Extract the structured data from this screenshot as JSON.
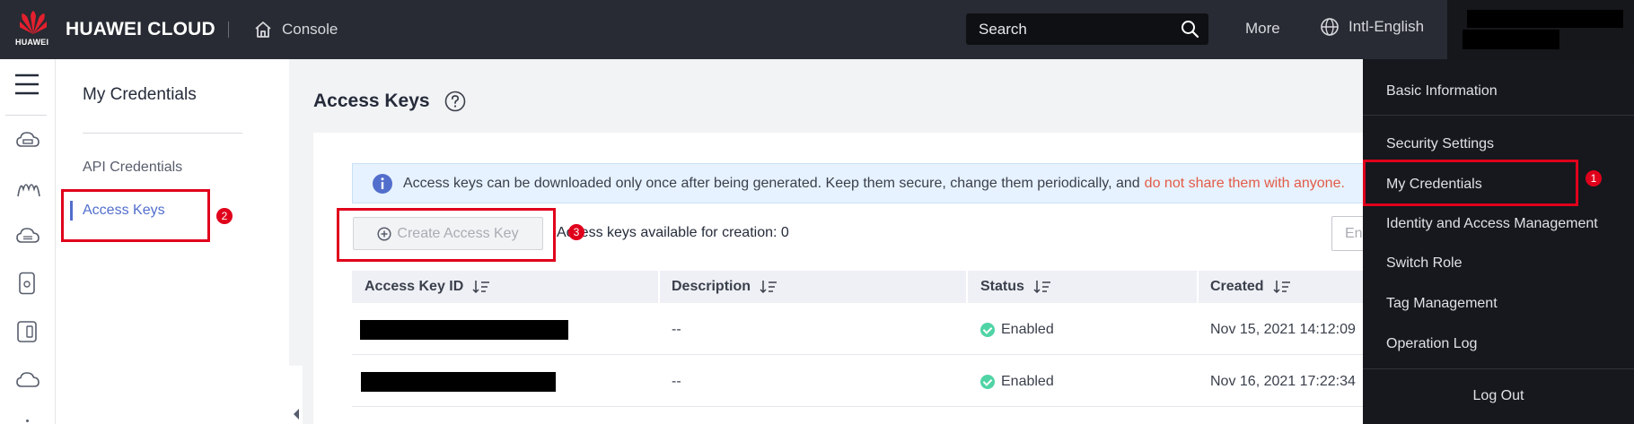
{
  "header": {
    "logo_text": "HUAWEI",
    "brand": "HUAWEI CLOUD",
    "console_label": "Console",
    "search_placeholder": "Search",
    "more_label": "More",
    "language_label": "Intl-English"
  },
  "rail": {
    "icons": [
      "menu-icon",
      "cloud-server-icon",
      "topology-icon",
      "cloud-storage-icon",
      "device-icon",
      "database-icon",
      "cloud-icon"
    ]
  },
  "subnav": {
    "title": "My Credentials",
    "items": [
      {
        "label": "API Credentials",
        "active": false
      },
      {
        "label": "Access Keys",
        "active": true
      }
    ]
  },
  "main": {
    "title": "Access Keys",
    "notice": {
      "text": "Access keys can be downloaded only once after being generated. Keep them secure, change them periodically, and",
      "warning": "do not share them with anyone."
    },
    "create_button": "Create Access Key",
    "availability": "Access keys available for creation: 0",
    "filter_placeholder": "En",
    "table": {
      "columns": [
        "Access Key ID",
        "Description",
        "Status",
        "Created"
      ],
      "rows": [
        {
          "description": "--",
          "status": "Enabled",
          "created": "Nov 15, 2021 14:12:09"
        },
        {
          "description": "--",
          "status": "Enabled",
          "created": "Nov 16, 2021 17:22:34"
        }
      ]
    }
  },
  "account_menu": {
    "items": [
      "Basic Information",
      "Security Settings",
      "My Credentials",
      "Identity and Access Management",
      "Switch Role",
      "Tag Management",
      "Operation Log"
    ],
    "logout": "Log Out"
  },
  "annotations": {
    "badges": [
      "1",
      "2",
      "3"
    ],
    "color": "#e0001b"
  },
  "colors": {
    "topbar": "#282b33",
    "accent": "#526ecc",
    "enabled": "#50d4a5",
    "warning_text": "#e35b47"
  }
}
